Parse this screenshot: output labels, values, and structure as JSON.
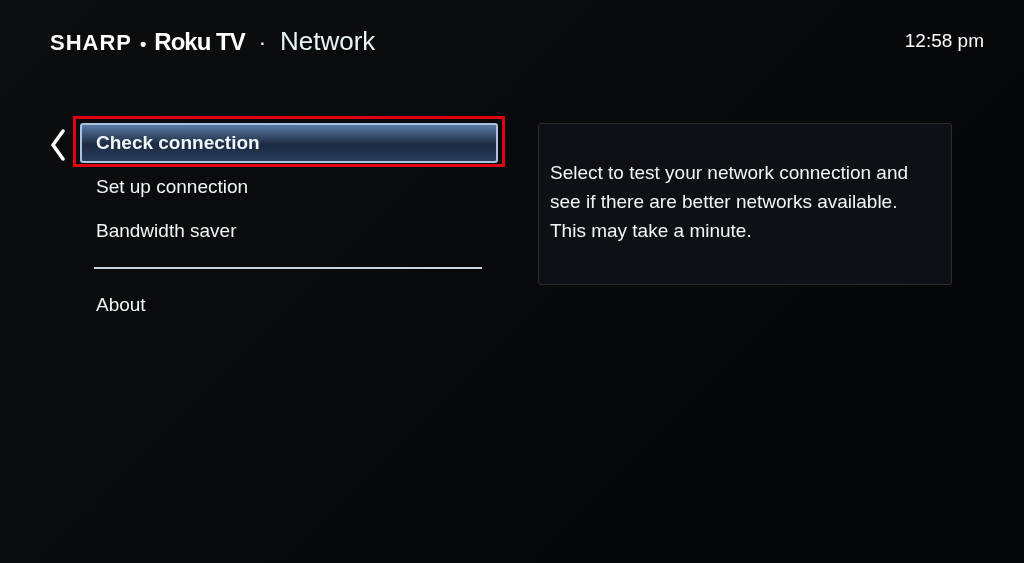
{
  "header": {
    "brand": "SHARP",
    "separator": "•",
    "product": "Roku TV",
    "title_separator": "·",
    "title": "Network",
    "time": "12:58 pm"
  },
  "menu": {
    "items": [
      {
        "label": "Check connection",
        "selected": true,
        "highlighted": true,
        "divider_before": false
      },
      {
        "label": "Set up connection",
        "selected": false,
        "highlighted": false,
        "divider_before": false
      },
      {
        "label": "Bandwidth saver",
        "selected": false,
        "highlighted": false,
        "divider_before": false
      },
      {
        "label": "About",
        "selected": false,
        "highlighted": false,
        "divider_before": true
      }
    ]
  },
  "description": "Select to test your network connection and see if there are better networks available. This may take a minute."
}
